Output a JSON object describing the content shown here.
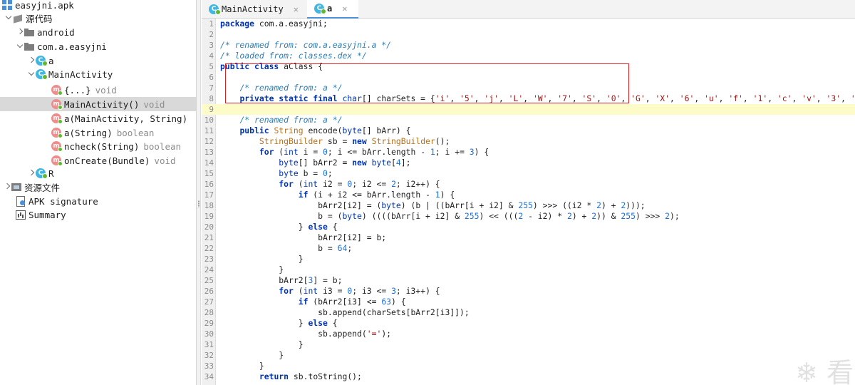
{
  "sidebar": {
    "apk": "easyjni.apk",
    "source_root": "源代码",
    "android": "android",
    "package": "com.a.easyjni",
    "class_a": "a",
    "main_activity": "MainActivity",
    "members": [
      {
        "name": "{...}",
        "type": "void",
        "icon": "static-init-icon"
      },
      {
        "name": "MainActivity()",
        "type": "void",
        "icon": "constructor-icon"
      },
      {
        "name": "a(MainActivity, String)",
        "type": "",
        "icon": "method-icon"
      },
      {
        "name": "a(String)",
        "type": "boolean",
        "icon": "method-icon"
      },
      {
        "name": "ncheck(String)",
        "type": "boolean",
        "icon": "method-icon"
      },
      {
        "name": "onCreate(Bundle)",
        "type": "void",
        "icon": "method-icon"
      }
    ],
    "class_r": "R",
    "resources": "资源文件",
    "apk_signature": "APK signature",
    "summary": "Summary"
  },
  "tabs": [
    {
      "label": "MainActivity",
      "active": false
    },
    {
      "label": "a",
      "active": true
    }
  ],
  "code_lines": [
    {
      "n": "1",
      "html": "<span class=\"kw\">package</span> com.a.easyjni;"
    },
    {
      "n": "2",
      "html": ""
    },
    {
      "n": "3",
      "html": "<span class=\"cm\">/* renamed from: com.a.easyjni.a */</span>"
    },
    {
      "n": "4",
      "html": "<span class=\"cm\">/* loaded from: classes.dex */</span>"
    },
    {
      "n": "5",
      "html": "<span class=\"kw\">public class</span> aClass {"
    },
    {
      "n": "6",
      "html": ""
    },
    {
      "n": "7",
      "html": "    <span class=\"cm\">/* renamed from: a */</span>"
    },
    {
      "n": "8",
      "html": "    <span class=\"kw\">private static final</span> <span class=\"ty\">char</span>[] charSets = {<span class=\"ch\">'i'</span>, <span class=\"ch\">'5'</span>, <span class=\"ch\">'j'</span>, <span class=\"ch\">'L'</span>, <span class=\"ch\">'W'</span>, <span class=\"ch\">'7'</span>, <span class=\"ch\">'S'</span>, <span class=\"ch\">'0'</span>, <span class=\"ch\">'G'</span>, <span class=\"ch\">'X'</span>, <span class=\"ch\">'6'</span>, <span class=\"ch\">'u'</span>, <span class=\"ch\">'f'</span>, <span class=\"ch\">'1'</span>, <span class=\"ch\">'c'</span>, <span class=\"ch\">'v'</span>, <span class=\"ch\">'3'</span>, <span class=\"ch\">'</span>"
    },
    {
      "n": "9",
      "html": "",
      "current": true
    },
    {
      "n": "10",
      "html": "    <span class=\"cm\">/* renamed from: a */</span>"
    },
    {
      "n": "11",
      "html": "    <span class=\"kw\">public</span> <span class=\"cl\">String</span> encode(<span class=\"ty\">byte</span>[] bArr) {"
    },
    {
      "n": "12",
      "html": "        <span class=\"cl\">StringBuilder</span> sb = <span class=\"kw\">new</span> <span class=\"cl\">StringBuilder</span>();"
    },
    {
      "n": "13",
      "html": "        <span class=\"kw\">for</span> (<span class=\"ty\">int</span> i = <span class=\"nm\">0</span>; i &lt;= bArr.length - <span class=\"nm\">1</span>; i += <span class=\"nm\">3</span>) {"
    },
    {
      "n": "14",
      "html": "            <span class=\"ty\">byte</span>[] bArr2 = <span class=\"kw\">new</span> <span class=\"ty\">byte</span>[<span class=\"nm\">4</span>];"
    },
    {
      "n": "15",
      "html": "            <span class=\"ty\">byte</span> b = <span class=\"nm\">0</span>;"
    },
    {
      "n": "16",
      "html": "            <span class=\"kw\">for</span> (<span class=\"ty\">int</span> i2 = <span class=\"nm\">0</span>; i2 &lt;= <span class=\"nm\">2</span>; i2++) {"
    },
    {
      "n": "17",
      "html": "                <span class=\"kw\">if</span> (i + i2 &lt;= bArr.length - <span class=\"nm\">1</span>) {"
    },
    {
      "n": "18",
      "html": "                    bArr2[i2] = (<span class=\"ty\">byte</span>) (b | ((bArr[i + i2] &amp; <span class=\"nm\">255</span>) &gt;&gt;&gt; ((i2 * <span class=\"nm\">2</span>) + <span class=\"nm\">2</span>)));"
    },
    {
      "n": "19",
      "html": "                    b = (<span class=\"ty\">byte</span>) ((((bArr[i + i2] &amp; <span class=\"nm\">255</span>) &lt;&lt; (((<span class=\"nm\">2</span> - i2) * <span class=\"nm\">2</span>) + <span class=\"nm\">2</span>)) &amp; <span class=\"nm\">255</span>) &gt;&gt;&gt; <span class=\"nm\">2</span>);"
    },
    {
      "n": "20",
      "html": "                } <span class=\"kw\">else</span> {"
    },
    {
      "n": "21",
      "html": "                    bArr2[i2] = b;"
    },
    {
      "n": "22",
      "html": "                    b = <span class=\"nm\">64</span>;"
    },
    {
      "n": "23",
      "html": "                }"
    },
    {
      "n": "24",
      "html": "            }"
    },
    {
      "n": "25",
      "html": "            bArr2[<span class=\"nm\">3</span>] = b;"
    },
    {
      "n": "26",
      "html": "            <span class=\"kw\">for</span> (<span class=\"ty\">int</span> i3 = <span class=\"nm\">0</span>; i3 &lt;= <span class=\"nm\">3</span>; i3++) {"
    },
    {
      "n": "27",
      "html": "                <span class=\"kw\">if</span> (bArr2[i3] &lt;= <span class=\"nm\">63</span>) {"
    },
    {
      "n": "28",
      "html": "                    sb.append(charSets[bArr2[i3]]);"
    },
    {
      "n": "29",
      "html": "                } <span class=\"kw\">else</span> {"
    },
    {
      "n": "30",
      "html": "                    sb.append(<span class=\"ch\">'='</span>);"
    },
    {
      "n": "31",
      "html": "                }"
    },
    {
      "n": "32",
      "html": "            }"
    },
    {
      "n": "33",
      "html": "        }"
    },
    {
      "n": "34",
      "html": "        <span class=\"kw\">return</span> sb.toString();"
    }
  ],
  "watermark": "❄ 看",
  "colors": {
    "keyword": "#0033b3",
    "comment": "#2e7db5",
    "char_literal": "#a31515",
    "highlight_box": "#e02020",
    "current_line": "#fdfbc8",
    "selected_row": "#d9d9d9"
  }
}
